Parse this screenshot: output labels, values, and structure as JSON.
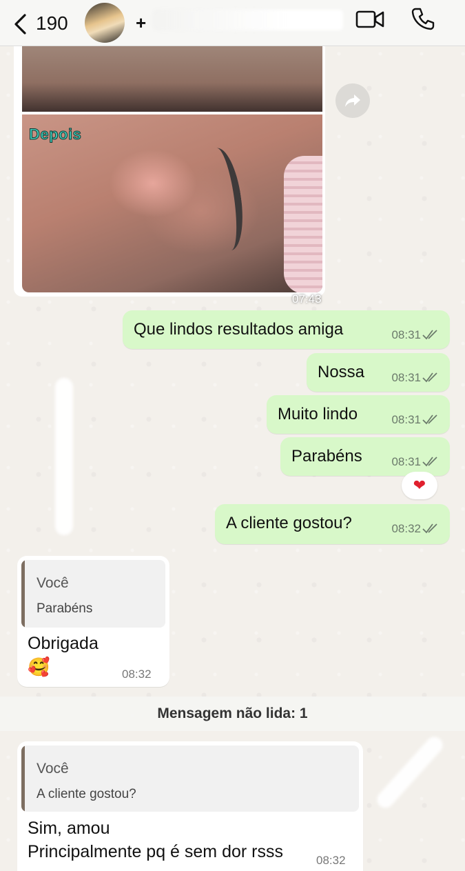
{
  "header": {
    "back_count": "190",
    "contact_name_visible": "+",
    "icons": [
      "chevron-left-icon",
      "video-camera-icon",
      "phone-icon"
    ]
  },
  "messages": {
    "image": {
      "overlay_label": "Depois",
      "time": "07:43"
    },
    "outgoing": [
      {
        "text": "Que lindos resultados amiga",
        "time": "08:31"
      },
      {
        "text": "Nossa",
        "time": "08:31"
      },
      {
        "text": "Muito lindo",
        "time": "08:31"
      },
      {
        "text": "Parabéns",
        "time": "08:31",
        "reaction": "❤"
      },
      {
        "text": "A cliente gostou?",
        "time": "08:32"
      }
    ],
    "reply1": {
      "quote_author": "Você",
      "quote_text": "Parabéns",
      "text": "Obrigada",
      "emoji": "🥰",
      "time": "08:32"
    },
    "unread_divider": "Mensagem não lida: 1",
    "reply2": {
      "quote_author": "Você",
      "quote_text": "A cliente gostou?",
      "line1": "Sim, amou",
      "line2": "Principalmente pq é sem dor rsss",
      "time": "08:32"
    }
  },
  "colors": {
    "outgoing_bubble": "#d8f8c9",
    "incoming_bubble": "#ffffff",
    "chat_background": "#f3f0eb",
    "reaction_heart": "#e0202e"
  }
}
